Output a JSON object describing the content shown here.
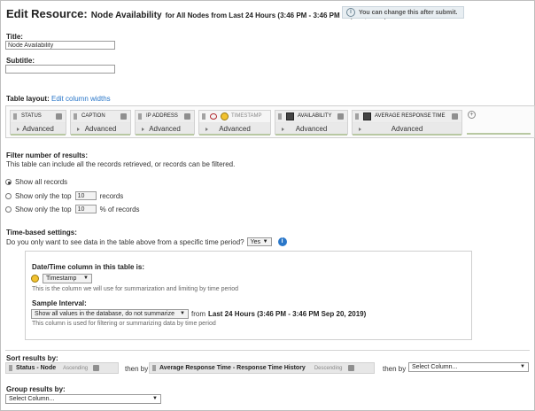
{
  "header": {
    "edit_label": "Edit Resource:",
    "resource_name": "Node Availability",
    "subtitle": "for All Nodes from Last 24 Hours (3:46 PM - 3:46 PM Sep 20, 2019)",
    "info_text": "You can change this after submit."
  },
  "form": {
    "title_label": "Title:",
    "title_value": "Node Availability",
    "subtitle_label": "Subtitle:",
    "subtitle_value": ""
  },
  "table_layout": {
    "label": "Table layout:",
    "edit_link": "Edit column widths",
    "columns": [
      {
        "name": "STATUS",
        "advanced": "Advanced"
      },
      {
        "name": "CAPTION",
        "advanced": "Advanced"
      },
      {
        "name": "IP ADDRESS",
        "advanced": "Advanced"
      },
      {
        "name": "TIMESTAMP",
        "advanced": "Advanced"
      },
      {
        "name": "AVAILABILITY",
        "advanced": "Advanced"
      },
      {
        "name": "AVERAGE RESPONSE TIME",
        "advanced": "Advanced"
      }
    ]
  },
  "filter": {
    "heading": "Filter number of results:",
    "description": "This table can include all the records retrieved, or records can be filtered.",
    "opt_all": "Show all records",
    "opt_top_prefix": "Show only the top",
    "opt_top_value": "10",
    "opt_top_suffix": "records",
    "opt_pct_prefix": "Show only the top",
    "opt_pct_value": "10",
    "opt_pct_suffix": "% of records"
  },
  "time": {
    "heading": "Time-based settings:",
    "question": "Do you only want to see data in the table above from a specific time period?",
    "answer": "Yes",
    "column_label": "Date/Time column in this table is:",
    "column_value": "Timestamp",
    "column_help": "This is the column we will use for summarization and limiting by time period",
    "interval_label": "Sample Interval:",
    "interval_value": "Show all values in the database, do not summarize",
    "interval_from": "from",
    "interval_period": "Last 24 Hours (3:46 PM - 3:46 PM Sep 20, 2019)",
    "interval_help": "This column is used for filtering or summarizing data by time period"
  },
  "sort": {
    "label": "Sort results by:",
    "first_field": "Status - Node",
    "first_order": "Ascending",
    "then_by_1": "then by",
    "second_field": "Average Response Time - Response Time History",
    "second_order": "Descending",
    "then_by_2": "then by",
    "third_select": "Select Column..."
  },
  "group": {
    "label": "Group results by:",
    "select": "Select Column..."
  }
}
